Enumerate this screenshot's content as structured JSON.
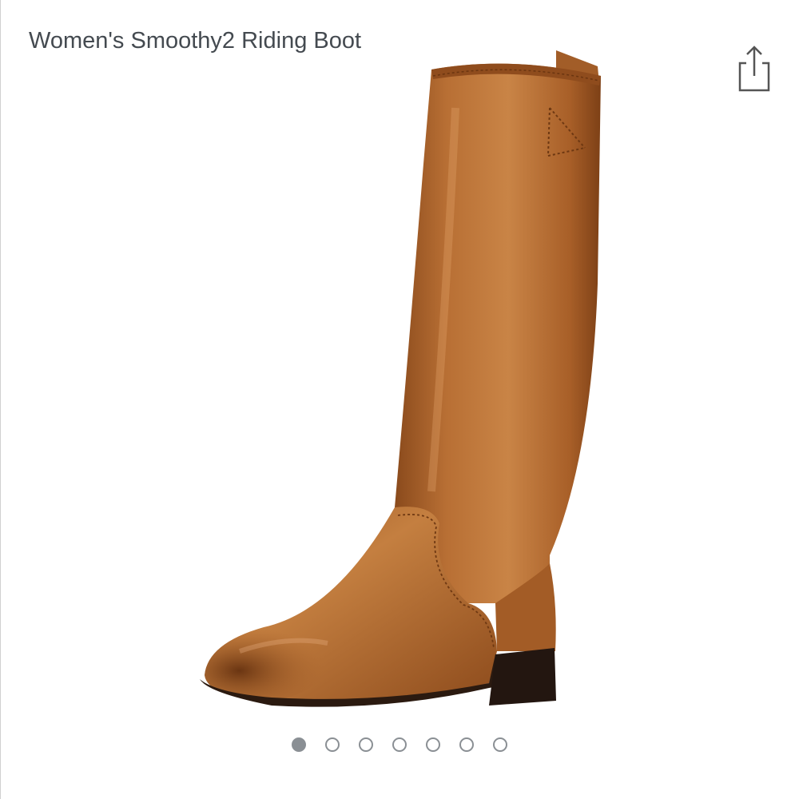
{
  "product": {
    "title": "Women's Smoothy2 Riding Boot"
  },
  "image_gallery": {
    "image_count": 7,
    "active_index": 0
  },
  "icons": {
    "share": "share-icon"
  },
  "colors": {
    "title_text": "#444a50",
    "dot": "#8a8f94",
    "boot_leather": "#b06a30"
  }
}
